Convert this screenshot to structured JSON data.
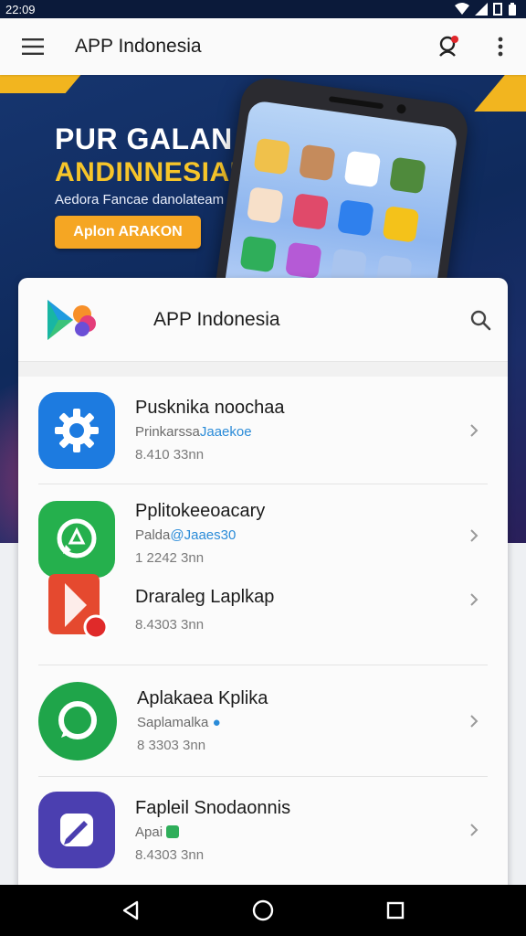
{
  "status_bar": {
    "time": "22:09"
  },
  "app_bar": {
    "title": "APP Indonesia"
  },
  "hero": {
    "title_line1": "PUR GALAN",
    "title_line2": "ANDINNESIAR",
    "subtitle": "Aedora Fancae danolateam",
    "cta_label": "Aplon ARAKON"
  },
  "card": {
    "title": "APP Indonesia"
  },
  "apps": [
    {
      "name": "Pusknika noochaa",
      "dev": "Prinkarssa",
      "dev_accent": "Jaaekoe",
      "size": "8.410 33nn",
      "icon": "settings-gear-icon",
      "color": "#1d7be0"
    },
    {
      "name": "Pplitokeeoacary",
      "dev": "Palda",
      "dev_accent": "@Jaaes30",
      "size": "1 2242 3nn",
      "icon": "whatsapp-icon",
      "color": "#25b04d"
    },
    {
      "name": "Draraleg Laplkap",
      "dev": "",
      "dev_accent": "",
      "size": "8.4303 3nn",
      "icon": "red-app-icon",
      "color": "#e5492f"
    },
    {
      "name": "Aplakaea Kplika",
      "dev": "Saplamalka",
      "dev_accent": "",
      "size": "8 3303 3nn",
      "icon": "chat-bubble-icon",
      "color": "#1fa54a"
    },
    {
      "name": "Fapleil Snodaonnis",
      "dev": "Apai",
      "dev_accent": "",
      "size": "8.4303 3nn",
      "icon": "pen-app-icon",
      "color": "#4b3fb0"
    }
  ]
}
